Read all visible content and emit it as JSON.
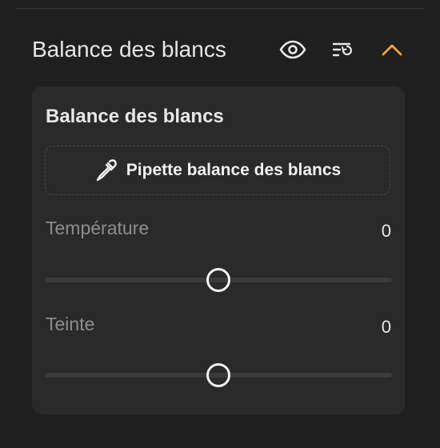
{
  "section": {
    "title": "Balance des blancs"
  },
  "card": {
    "title": "Balance des blancs",
    "eyedropper_label": "Pipette balance des blancs"
  },
  "sliders": {
    "temperature": {
      "label": "Température",
      "value": "0",
      "fraction": 0.5
    },
    "tint": {
      "label": "Teinte",
      "value": "0",
      "fraction": 0.5
    }
  },
  "icons": {
    "visibility": "eye-icon",
    "reset": "reset-list-icon",
    "collapse": "chevron-up-icon"
  },
  "colors": {
    "accent": "#f0a63a",
    "background": "#1f1f1f",
    "card": "#2a2a2a"
  }
}
